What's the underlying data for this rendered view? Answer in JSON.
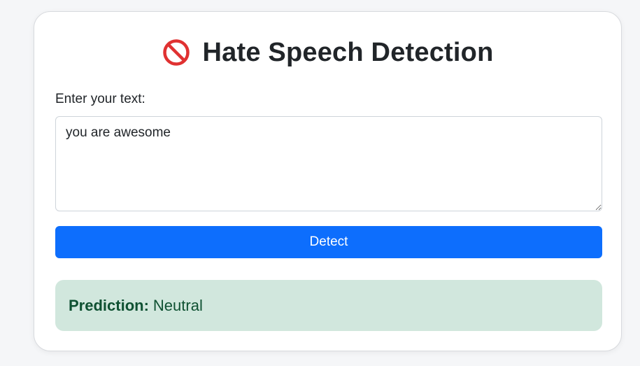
{
  "header": {
    "icon": "prohibited-icon",
    "title": "Hate Speech Detection"
  },
  "form": {
    "label": "Enter your text:",
    "input_value": "you are awesome",
    "button_label": "Detect"
  },
  "result": {
    "key": "Prediction:",
    "value": "Neutral"
  },
  "colors": {
    "accent": "#0d6efd",
    "success_bg": "#d1e7dd",
    "success_text": "#0f5132",
    "prohibit_red": "#e03131"
  }
}
